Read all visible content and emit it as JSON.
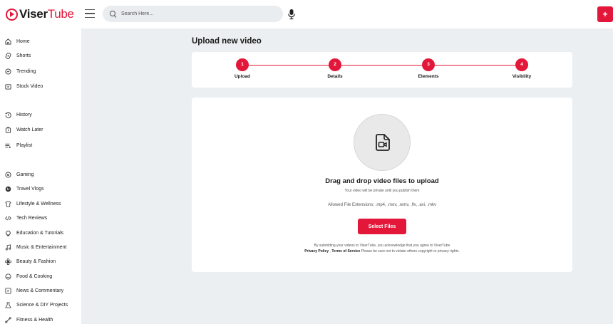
{
  "header": {
    "logo_part1": "Viser",
    "logo_part2": "Tube",
    "search_placeholder": "Search Here...",
    "add_label": "+"
  },
  "sidebar": {
    "primary": [
      {
        "label": "Home",
        "icon": "home-icon"
      },
      {
        "label": "Shorts",
        "icon": "shorts-icon"
      },
      {
        "label": "Trending",
        "icon": "trending-icon"
      },
      {
        "label": "Stock Video",
        "icon": "stock-video-icon"
      }
    ],
    "library": [
      {
        "label": "History",
        "icon": "history-icon"
      },
      {
        "label": "Watch Later",
        "icon": "watch-later-icon"
      },
      {
        "label": "Playlist",
        "icon": "playlist-icon"
      }
    ],
    "categories": [
      {
        "label": "Gaming",
        "icon": "gaming-icon"
      },
      {
        "label": "Travel Vlogs",
        "icon": "globe-icon"
      },
      {
        "label": "Lifestyle & Wellness",
        "icon": "shirt-icon"
      },
      {
        "label": "Tech Reviews",
        "icon": "code-icon"
      },
      {
        "label": "Education & Tutorials",
        "icon": "education-icon"
      },
      {
        "label": "Music & Entertainment",
        "icon": "music-icon"
      },
      {
        "label": "Beauty & Fashion",
        "icon": "flower-icon"
      },
      {
        "label": "Food & Cooking",
        "icon": "food-icon"
      },
      {
        "label": "News & Commentary",
        "icon": "news-icon"
      },
      {
        "label": "Science & DIY Projects",
        "icon": "science-icon"
      },
      {
        "label": "Fitness & Health",
        "icon": "fitness-icon"
      }
    ]
  },
  "main": {
    "title": "Upload new video",
    "steps": [
      {
        "number": "1",
        "label": "Upload"
      },
      {
        "number": "2",
        "label": "Details"
      },
      {
        "number": "3",
        "label": "Elements"
      },
      {
        "number": "4",
        "label": "Visibility"
      }
    ],
    "upload": {
      "heading": "Drag and drop video files to upload",
      "private_note": "Your video will be private until you publish them",
      "extensions": "Allowed File Extensions: .mp4, .mov, .wmv, .flv, .avi, .mkv",
      "button": "Select Files",
      "terms_line1": "By submitting your videos to ViserTube, you acknowledge that you agree to ViserTube",
      "privacy_link": "Privacy Policy",
      "separator": " , ",
      "terms_link": "Terms of Service",
      "terms_line2": " Please be sure not to violate others copyright or privacy rights."
    }
  },
  "colors": {
    "accent": "#e2173a",
    "background": "#ebeff1",
    "card": "#ffffff"
  }
}
